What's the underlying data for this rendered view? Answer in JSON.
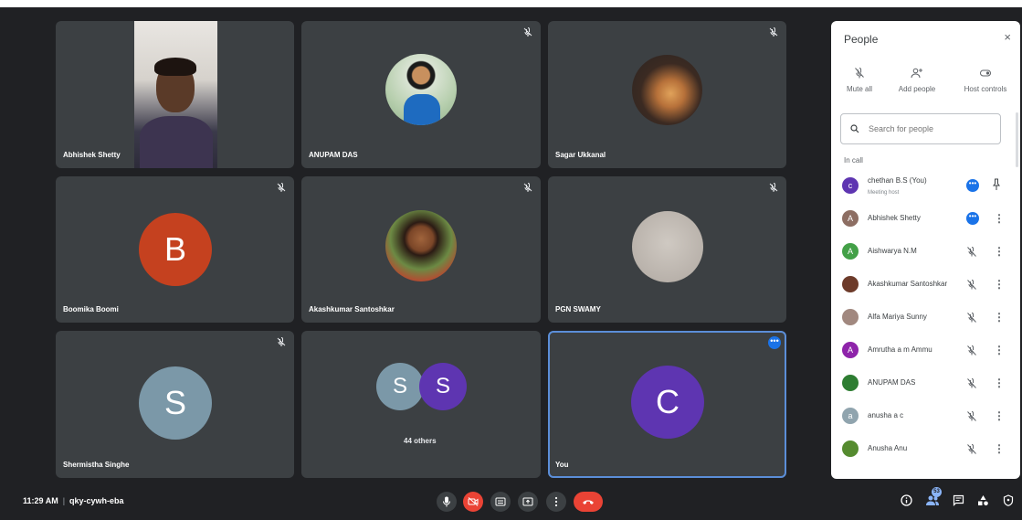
{
  "tiles": [
    {
      "name": "Abhishek Shetty"
    },
    {
      "name": "ANUPAM DAS"
    },
    {
      "name": "Sagar Ukkanal"
    },
    {
      "name": "Boomika Boomi",
      "initial": "B",
      "color": "#c5411f"
    },
    {
      "name": "Akashkumar Santoshkar"
    },
    {
      "name": "PGN SWAMY"
    },
    {
      "name": "Shermistha Singhe",
      "initial": "S",
      "color": "#7b98a8"
    },
    {
      "others_label": "44 others",
      "initials": [
        "S",
        "S"
      ],
      "colors": [
        "#7b98a8",
        "#5e35b1"
      ]
    },
    {
      "name": "You",
      "initial": "C",
      "color": "#5e35b1",
      "more": "•••"
    }
  ],
  "panel": {
    "title": "People",
    "close": "×",
    "actions": {
      "mute_all": "Mute all",
      "add_people": "Add people",
      "host_controls": "Host controls"
    },
    "search_placeholder": "Search for people",
    "section_label": "In call",
    "participants": [
      {
        "name": "chethan B.S (You)",
        "subtitle": "Meeting host",
        "initial": "c",
        "color": "#5e35b1"
      },
      {
        "name": "Abhishek Shetty",
        "initial": "A",
        "color": "#8d6e63"
      },
      {
        "name": "Aishwarya N.M",
        "initial": "A",
        "color": "#43a047"
      },
      {
        "name": "Akashkumar Santoshkar",
        "initial": "",
        "color": "#6d3b2a"
      },
      {
        "name": "Alfa Mariya Sunny",
        "initial": "",
        "color": "#a1887f"
      },
      {
        "name": "Amrutha a m Ammu",
        "initial": "A",
        "color": "#8e24aa"
      },
      {
        "name": "ANUPAM DAS",
        "initial": "",
        "color": "#2e7d32"
      },
      {
        "name": "anusha a c",
        "initial": "a",
        "color": "#90a4ae"
      },
      {
        "name": "Anusha Anu",
        "initial": "",
        "color": "#558b2f"
      }
    ]
  },
  "bottom": {
    "time": "11:29 AM",
    "meeting_code": "qky-cywh-eba",
    "people_count": "53"
  },
  "colors": {
    "background": "#202124",
    "tile": "#3c4043",
    "accent": "#1a73e8",
    "end_call": "#ea4335"
  }
}
